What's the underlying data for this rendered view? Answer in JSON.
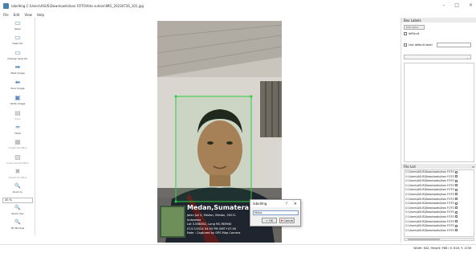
{
  "window": {
    "title": "labelImg C:\\Users\\ASUS\\Downloads\\ikan FOTO\\foto suhani\\IMG_20230726_101.jpg",
    "controls": [
      "–",
      "□",
      "×"
    ]
  },
  "menu": [
    "File",
    "Edit",
    "View",
    "Help"
  ],
  "toolbar": {
    "tools": [
      {
        "label": "Open",
        "icon": "folder-open-icon",
        "glyph": "▭",
        "enabled": true
      },
      {
        "label": "Open Dir",
        "icon": "folder-icon",
        "glyph": "▭",
        "enabled": true
      },
      {
        "label": "Change Save Dir",
        "icon": "folder-save-icon",
        "glyph": "▭",
        "enabled": true
      },
      {
        "label": "Next Image",
        "icon": "next-arrow-icon",
        "glyph": "➡",
        "enabled": true
      },
      {
        "label": "Prev Image",
        "icon": "prev-arrow-icon",
        "glyph": "⬅",
        "enabled": true
      },
      {
        "label": "Verify Image",
        "icon": "verify-icon",
        "glyph": "▣",
        "enabled": true
      },
      {
        "label": "Save",
        "icon": "save-icon",
        "glyph": "▤",
        "enabled": false
      },
      {
        "label": "YOLO",
        "icon": "format-icon",
        "glyph": "═",
        "enabled": true
      },
      {
        "label": "Create RectBox",
        "icon": "create-box-icon",
        "glyph": "▦",
        "enabled": false
      },
      {
        "label": "Duplicate RectBox",
        "icon": "duplicate-icon",
        "glyph": "▧",
        "enabled": false
      },
      {
        "label": "Delete RectBox",
        "icon": "delete-icon",
        "glyph": "✖",
        "enabled": false
      },
      {
        "label": "Zoom In",
        "icon": "zoom-in-icon",
        "glyph": "🔍",
        "enabled": true
      },
      {
        "label": "Zoom Out",
        "icon": "zoom-out-icon",
        "glyph": "🔍",
        "enabled": true
      },
      {
        "label": "Fit Window",
        "icon": "fit-window-icon",
        "glyph": "🔍",
        "enabled": true
      }
    ],
    "zoom_value": "40 %"
  },
  "photo": {
    "overlay_title": "Medan,Sumatera Utara,",
    "overlay_lines": [
      "Jalan Juli II, Medan, Medan, 20211",
      "Indonesia",
      "Lat 3.588382, Long 98.768940",
      "07/17/2024 04:55 PM GMT+07:00",
      "Note : Captured by GPS Map Camera"
    ]
  },
  "dialog": {
    "title": "labelImg",
    "help": "?",
    "close": "×",
    "input_value": "Muka",
    "ok_label": "OK",
    "cancel_label": "Cancel"
  },
  "right_panel": {
    "box_labels_title": "Box Labels",
    "edit_label_button": "Edit Label",
    "difficult_label": "difficult",
    "use_default_label": "Use default label",
    "file_list_title": "File List",
    "files": [
      "C:\\Users\\ASUS\\Downloads\\ikan FOTO",
      "C:\\Users\\ASUS\\Downloads\\ikan FOTO",
      "C:\\Users\\ASUS\\Downloads\\ikan FOTO",
      "C:\\Users\\ASUS\\Downloads\\ikan FOTO",
      "C:\\Users\\ASUS\\Downloads\\ikan FOTO",
      "C:\\Users\\ASUS\\Downloads\\ikan FOTO",
      "C:\\Users\\ASUS\\Downloads\\ikan FOTO",
      "C:\\Users\\ASUS\\Downloads\\ikan FOTO",
      "C:\\Users\\ASUS\\Downloads\\ikan FOTO",
      "C:\\Users\\ASUS\\Downloads\\ikan FOTO",
      "C:\\Users\\ASUS\\Downloads\\ikan FOTO",
      "C:\\Users\\ASUS\\Downloads\\ikan FOTO",
      "C:\\Users\\ASUS\\Downloads\\ikan FOTO",
      "C:\\Users\\ASUS\\Downloads\\ikan FOTO"
    ]
  },
  "status": {
    "text": "Width: 642, Height: 968 / X: 818; Y: 1156"
  },
  "colors": {
    "bbox": "#2ecc40",
    "accent": "#5c87b8"
  }
}
